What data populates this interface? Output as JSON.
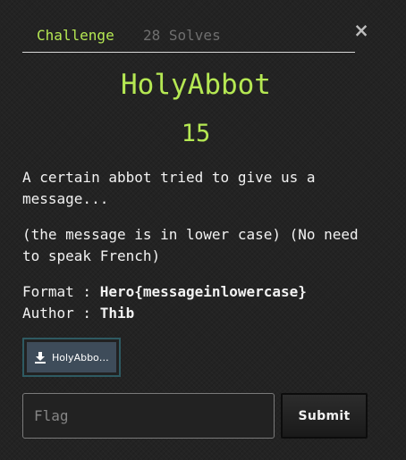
{
  "modal": {
    "close_glyph": "×",
    "tabs": [
      {
        "label": "Challenge",
        "active": true
      },
      {
        "label": "28 Solves",
        "active": false
      }
    ],
    "title": "HolyAbbot",
    "points": "15",
    "description": [
      "A certain abbot tried to give us a message...",
      "(the message is in lower case) (No need to speak French)"
    ],
    "format_label": "Format : ",
    "format_value": "Hero{messageinlowercase}",
    "author_label": "Author : ",
    "author_value": "Thib",
    "file": {
      "label": "HolyAbbot...",
      "icon": "download-icon"
    },
    "flag_input": {
      "placeholder": "Flag",
      "value": ""
    },
    "submit_label": "Submit"
  },
  "colors": {
    "accent": "#b5e853",
    "background": "#232323",
    "text": "#f2f2f2",
    "muted": "#6f6f6f",
    "file_button": "#3e4c5a",
    "file_border": "#2e5a62"
  }
}
